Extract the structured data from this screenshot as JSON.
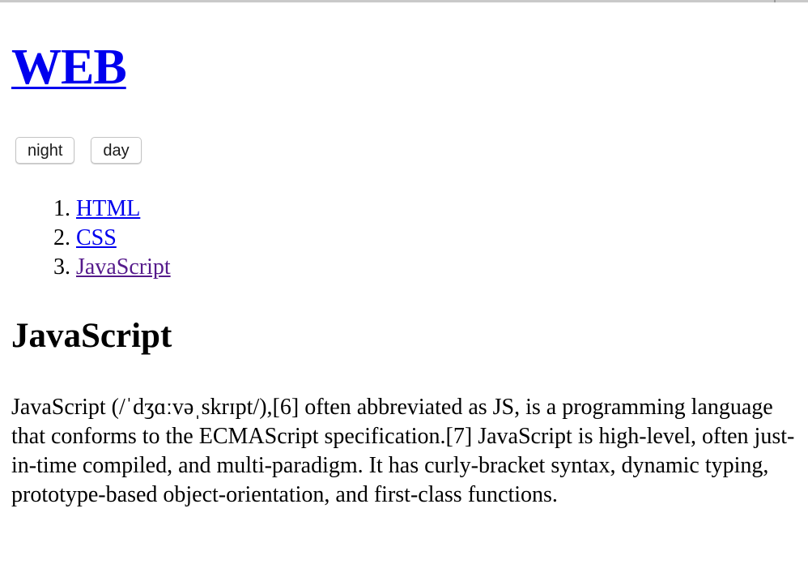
{
  "site": {
    "title": "WEB"
  },
  "mode_buttons": {
    "night_label": "night",
    "day_label": "day"
  },
  "nav": {
    "items": [
      {
        "number": "1.",
        "label": "HTML",
        "visited": false
      },
      {
        "number": "2.",
        "label": "CSS",
        "visited": false
      },
      {
        "number": "3.",
        "label": "JavaScript",
        "visited": true
      }
    ]
  },
  "article": {
    "title": "JavaScript",
    "body": "JavaScript (/ˈdʒɑːvəˌskrɪpt/),[6] often abbreviated as JS, is a programming language that conforms to the ECMAScript specification.[7] JavaScript is high-level, often just-in-time compiled, and multi-paradigm. It has curly-bracket syntax, dynamic typing, prototype-based object-orientation, and first-class functions."
  },
  "colors": {
    "link": "#0000ee",
    "visited_link": "#551a8b",
    "background": "#ffffff",
    "text": "#000000"
  }
}
